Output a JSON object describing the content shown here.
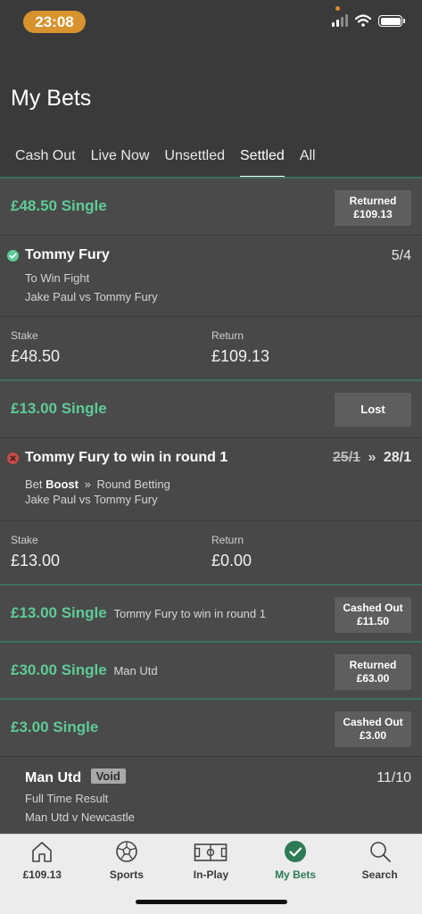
{
  "status_bar": {
    "time": "23:08"
  },
  "header": {
    "title": "My Bets",
    "tabs": [
      {
        "label": "Cash Out",
        "active": false
      },
      {
        "label": "Live Now",
        "active": false
      },
      {
        "label": "Unsettled",
        "active": false
      },
      {
        "label": "Settled",
        "active": true
      },
      {
        "label": "All",
        "active": false
      }
    ]
  },
  "bets": [
    {
      "title": "£48.50 Single",
      "status_line1": "Returned",
      "status_line2": "£109.13",
      "selection": {
        "icon": "check-icon",
        "name": "Tommy Fury",
        "market": "To Win Fight",
        "event": "Jake Paul vs Tommy Fury",
        "odds": "5/4"
      },
      "stake_label": "Stake",
      "stake": "£48.50",
      "return_label": "Return",
      "return": "£109.13"
    },
    {
      "title": "£13.00 Single",
      "status_line1": "Lost",
      "selection": {
        "icon": "cross-icon",
        "name": "Tommy Fury to win in round 1",
        "old_odds": "25/1",
        "odds": "28/1",
        "boost_prefix": "Bet",
        "boost_word": "Boost",
        "boost_market": "Round Betting",
        "event": "Jake Paul vs Tommy Fury"
      },
      "stake_label": "Stake",
      "stake": "£13.00",
      "return_label": "Return",
      "return": "£0.00"
    },
    {
      "title": "£13.00 Single",
      "subtitle": "Tommy Fury to win in round 1",
      "status_line1": "Cashed Out",
      "status_line2": "£11.50"
    },
    {
      "title": "£30.00 Single",
      "subtitle": "Man Utd",
      "status_line1": "Returned",
      "status_line2": "£63.00"
    },
    {
      "title": "£3.00 Single",
      "status_line1": "Cashed Out",
      "status_line2": "£3.00",
      "selection": {
        "name": "Man Utd",
        "badge": "Void",
        "market": "Full Time Result",
        "event": "Man Utd v Newcastle",
        "odds": "11/10"
      }
    }
  ],
  "bottom_nav": [
    {
      "label": "£109.13",
      "icon": "home-icon",
      "active": false
    },
    {
      "label": "Sports",
      "icon": "football-icon",
      "active": false
    },
    {
      "label": "In-Play",
      "icon": "pitch-icon",
      "active": false
    },
    {
      "label": "My Bets",
      "icon": "check-circle-icon",
      "active": true
    },
    {
      "label": "Search",
      "icon": "search-icon",
      "active": false
    }
  ],
  "colors": {
    "accent": "#5ecb98",
    "nav_active": "#2d7a57",
    "time_pill": "#d8922e",
    "lost": "#c94a4a"
  }
}
